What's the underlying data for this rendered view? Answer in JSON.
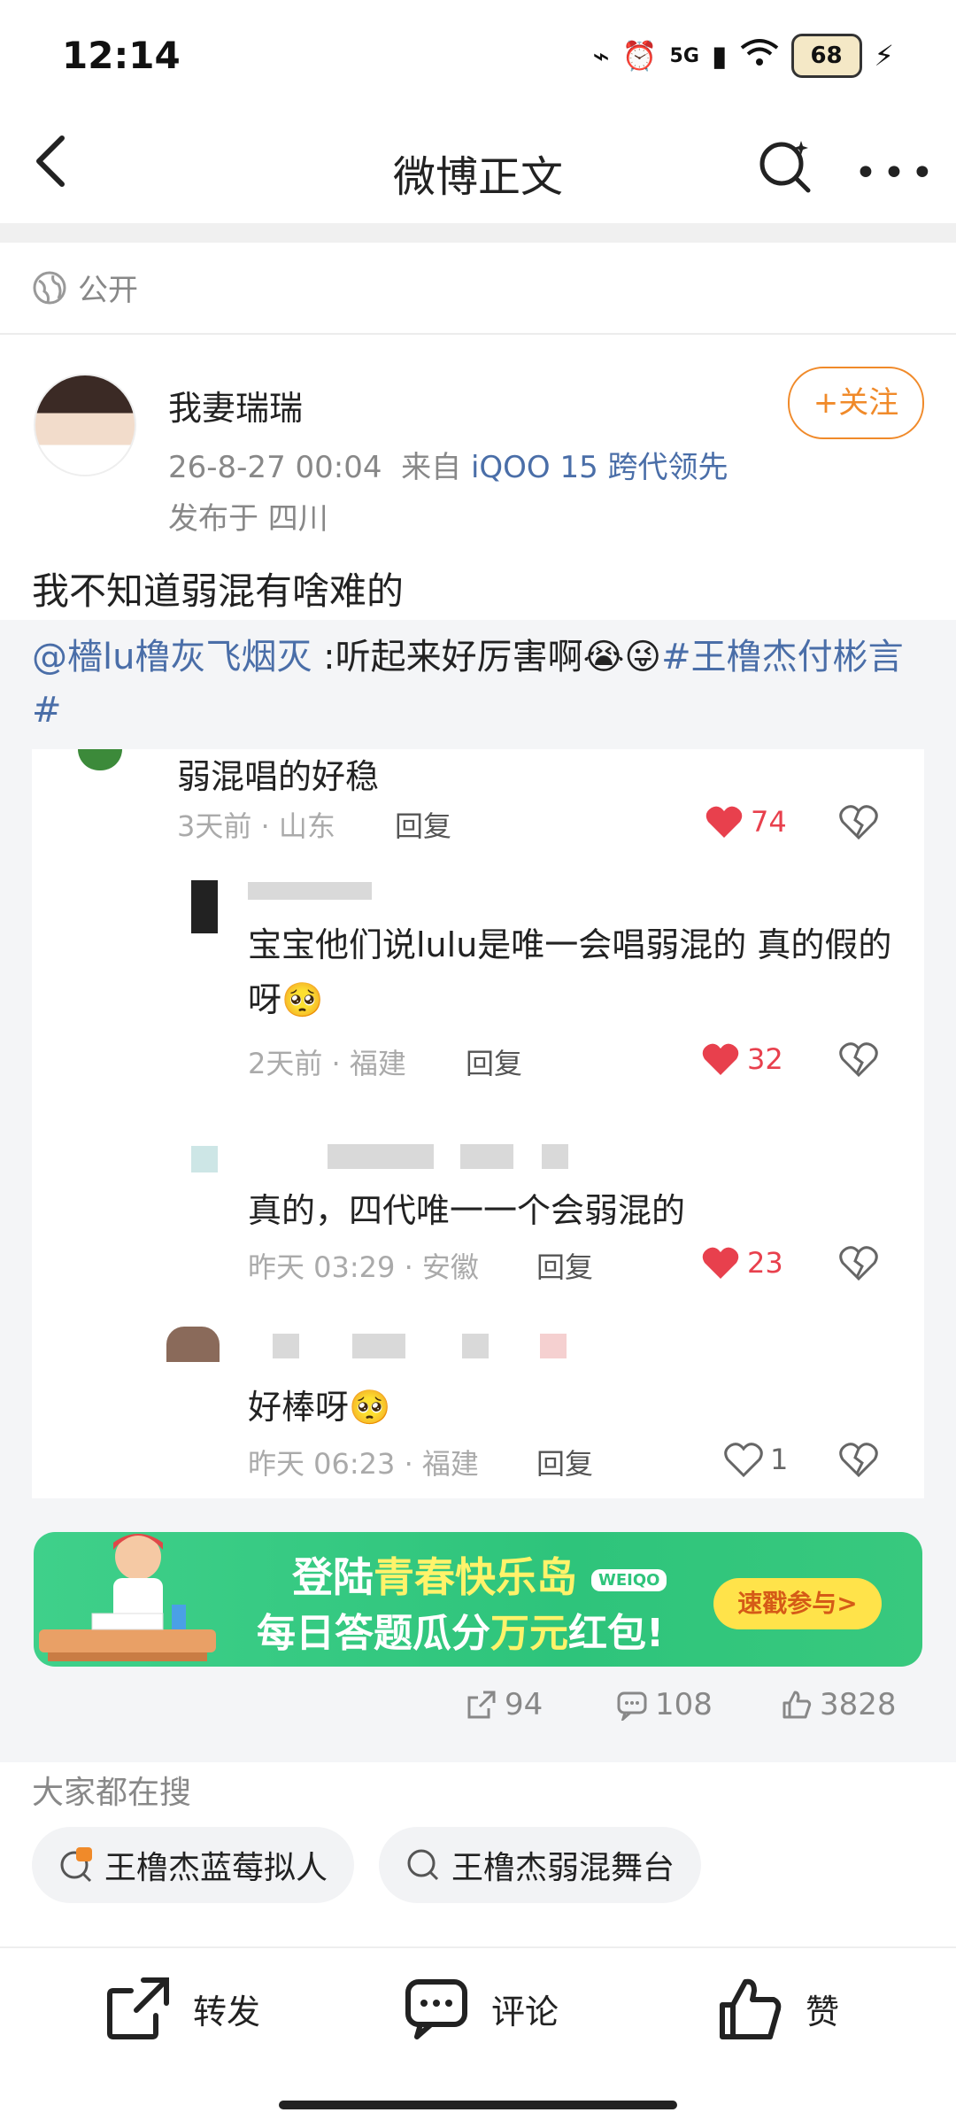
{
  "status_bar": {
    "time": "12:14",
    "network": "5G",
    "battery": "68"
  },
  "header": {
    "title": "微博正文"
  },
  "post": {
    "visibility": "公开",
    "username": "我妻瑞瑞",
    "follow_label": "+关注",
    "timestamp": "26-8-27 00:04",
    "from_label": "来自",
    "source": "iQOO 15 跨代领先",
    "location": "发布于 四川",
    "text": "我不知道弱混有啥难的"
  },
  "repost": {
    "mention": "@檣lu橹灰飞烟灭",
    "text": " :听起来好厉害啊😭😜",
    "tag_line1": "#王橹杰付彬言",
    "tag_line2": "#"
  },
  "comments": [
    {
      "text": "弱混唱的好稳",
      "time": "3天前",
      "location": "山东",
      "reply": "回复",
      "likes": "74",
      "liked": true
    },
    {
      "text": "宝宝他们说lulu是唯一会唱弱混的 真的假的呀🥺",
      "time": "2天前",
      "location": "福建",
      "reply": "回复",
      "likes": "32",
      "liked": true
    },
    {
      "text": "真的，四代唯一一个会弱混的",
      "time": "昨天 03:29",
      "location": "安徽",
      "reply": "回复",
      "likes": "23",
      "liked": true
    },
    {
      "text": "好棒呀🥺",
      "time": "昨天 06:23",
      "location": "福建",
      "reply": "回复",
      "likes": "1",
      "liked": false
    }
  ],
  "banner": {
    "line1_pre": "登陆",
    "line1_hl": "青春快乐岛",
    "badge": "WEIQO",
    "line2_pre": "每日答题瓜分",
    "line2_hl": "万元",
    "line2_post": "红包!",
    "button": "速戳参与>"
  },
  "stats": {
    "reposts": "94",
    "comments": "108",
    "likes": "3828"
  },
  "search": {
    "title": "大家都在搜",
    "chips": [
      {
        "label": "王橹杰蓝莓拟人",
        "icon": "hot-search-icon"
      },
      {
        "label": "王橹杰弱混舞台",
        "icon": "search-icon"
      }
    ]
  },
  "bottom_bar": {
    "repost": "转发",
    "comment": "评论",
    "like": "赞"
  },
  "colors": {
    "accent_orange": "#f08a2a",
    "link_blue": "#4a6ea8",
    "like_red": "#e8404d",
    "banner_green": "#2ec47b"
  }
}
